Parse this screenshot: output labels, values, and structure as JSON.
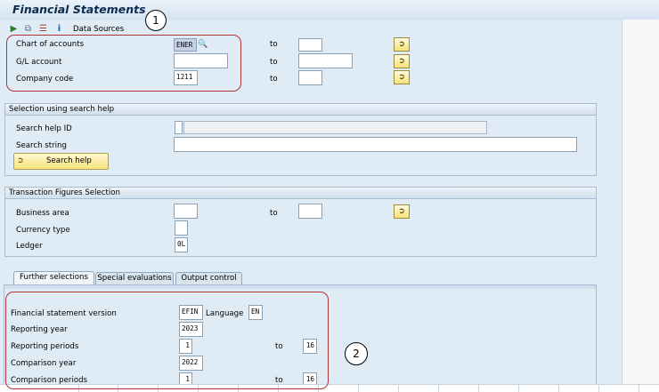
{
  "title": "Financial Statements",
  "toolbar": {
    "data_sources_label": "Data Sources",
    "icons": [
      "execute-icon",
      "copy-variant-icon",
      "list-icon",
      "info-icon"
    ]
  },
  "top_selection": {
    "rows": [
      {
        "label": "Chart of accounts",
        "value": "ENER",
        "to_label": "to",
        "to_value": ""
      },
      {
        "label": "G/L account",
        "value": "",
        "to_label": "to",
        "to_value": ""
      },
      {
        "label": "Company code",
        "value": "1211",
        "to_label": "to",
        "to_value": ""
      }
    ]
  },
  "search_help_group": {
    "title": "Selection using search help",
    "id_label": "Search help ID",
    "id_value": "",
    "string_label": "Search string",
    "string_value": "",
    "button_label": "Search help"
  },
  "transaction_group": {
    "title": "Transaction Figures Selection",
    "business_area_label": "Business area",
    "business_area_value": "",
    "to_label": "to",
    "to_value": "",
    "currency_label": "Currency type",
    "currency_value": "",
    "ledger_label": "Ledger",
    "ledger_value": "0L"
  },
  "tabs": [
    {
      "label": "Further selections",
      "active": true
    },
    {
      "label": "Special evaluations",
      "active": false
    },
    {
      "label": "Output control",
      "active": false
    }
  ],
  "further": {
    "fsv_label": "Financial statement version",
    "fsv_value": "EFIN",
    "language_label": "Language",
    "language_value": "EN",
    "rep_year_label": "Reporting year",
    "rep_year_value": "2023",
    "rep_periods_label": "Reporting periods",
    "rep_period_from": "1",
    "rep_to_label": "to",
    "rep_period_to": "16",
    "cmp_year_label": "Comparison year",
    "cmp_year_value": "2022",
    "cmp_periods_label": "Comparison periods",
    "cmp_period_from": "1",
    "cmp_to_label": "to",
    "cmp_period_to": "16"
  },
  "annotations": {
    "one": "1",
    "two": "2"
  },
  "colors": {
    "annotation_box": "#b2323a",
    "background": "#dfebf5",
    "button": "#f7e27c"
  }
}
